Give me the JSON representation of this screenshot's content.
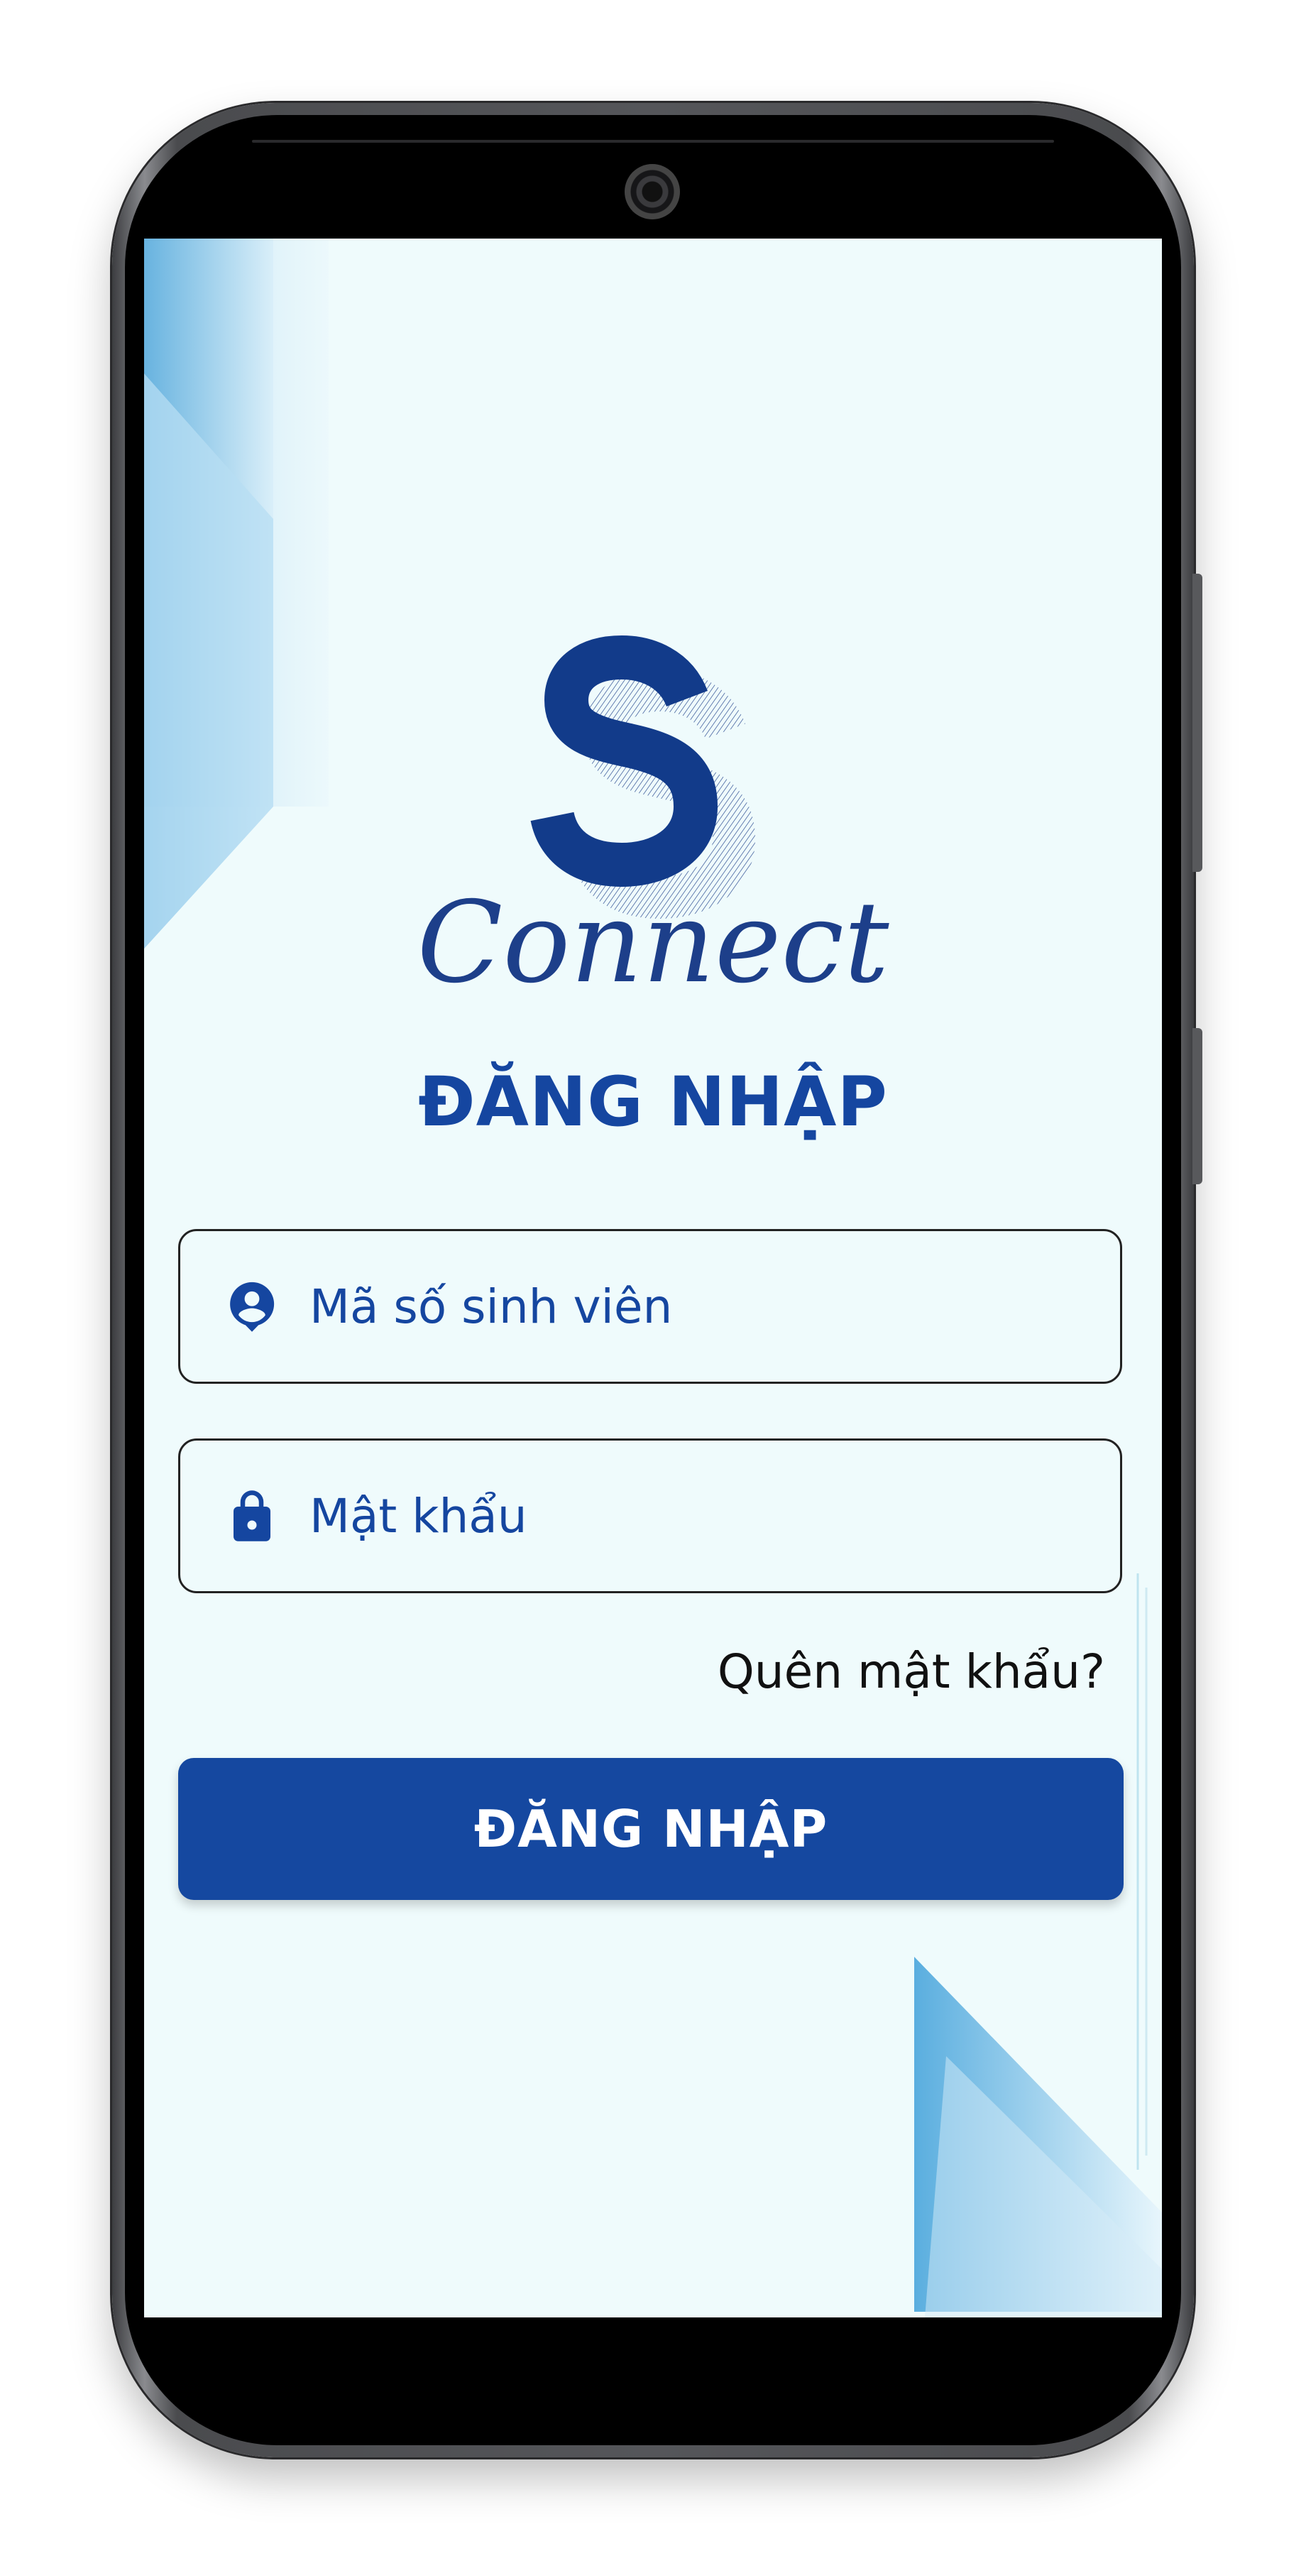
{
  "app": {
    "logo_text": "Connect",
    "logo_letter": "S"
  },
  "login": {
    "title": "ĐĂNG NHẬP",
    "student_id_placeholder": "Mã số sinh viên",
    "student_id_value": "",
    "password_placeholder": "Mật khẩu",
    "password_value": "",
    "forgot_password": "Quên mật khẩu?",
    "submit_label": "ĐĂNG NHẬP"
  },
  "icons": {
    "user": "account-circle-icon",
    "password": "lock-icon"
  },
  "colors": {
    "primary": "#1548a0",
    "text_primary": "#1546a0",
    "background": "#effbfc",
    "deco_blue": "#4ea6d8"
  }
}
